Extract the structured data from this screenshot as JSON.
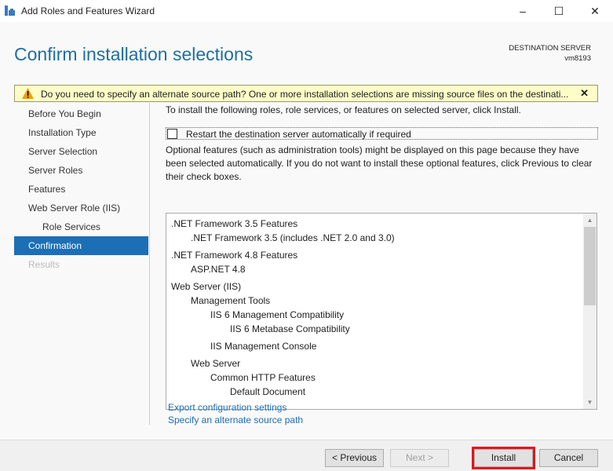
{
  "window": {
    "title": "Add Roles and Features Wizard",
    "minimize": "–",
    "maximize": "☐",
    "close": "✕"
  },
  "header": {
    "title": "Confirm installation selections",
    "dest_label": "DESTINATION SERVER",
    "dest_server": "vm8193"
  },
  "banner": {
    "text": "Do you need to specify an alternate source path? One or more installation selections are missing source files on the destinati...",
    "close": "✕"
  },
  "nav": {
    "items": [
      {
        "label": "Before You Begin"
      },
      {
        "label": "Installation Type"
      },
      {
        "label": "Server Selection"
      },
      {
        "label": "Server Roles"
      },
      {
        "label": "Features"
      },
      {
        "label": "Web Server Role (IIS)"
      },
      {
        "label": "Role Services"
      },
      {
        "label": "Confirmation"
      },
      {
        "label": "Results"
      }
    ]
  },
  "content": {
    "intro": "To install the following roles, role services, or features on selected server, click Install.",
    "restart_label": "Restart the destination server automatically if required",
    "restart_checked": false,
    "optional_text": "Optional features (such as administration tools) might be displayed on this page because they have been selected automatically. If you do not want to install these optional features, click Previous to clear their check boxes.",
    "features": [
      ".NET Framework 3.5 Features",
      ".NET Framework 3.5 (includes .NET 2.0 and 3.0)",
      ".NET Framework 4.8 Features",
      "ASP.NET 4.8",
      "Web Server (IIS)",
      "Management Tools",
      "IIS 6 Management Compatibility",
      "IIS 6 Metabase Compatibility",
      "IIS Management Console",
      "Web Server",
      "Common HTTP Features",
      "Default Document"
    ],
    "export_link": "Export configuration settings",
    "alt_source_link": "Specify an alternate source path"
  },
  "footer": {
    "previous": "< Previous",
    "next": "Next >",
    "install": "Install",
    "cancel": "Cancel"
  }
}
